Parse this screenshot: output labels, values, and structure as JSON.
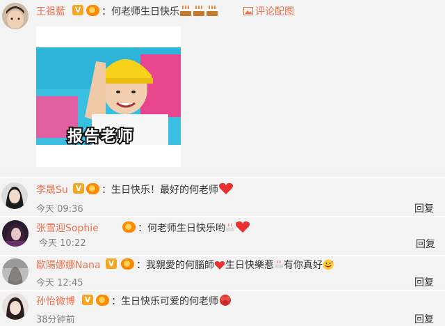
{
  "comments": [
    {
      "user": "王祖藍",
      "text": "：何老师生日快乐",
      "pic_link": "评论配图",
      "emoji": [
        "cake-emoji",
        "cake-emoji",
        "cake-emoji"
      ]
    },
    {
      "user": "李晟Su",
      "text": "：生日快乐！最好的何老师",
      "time": "今天 09:36",
      "reply": "回复"
    },
    {
      "user": "张雪迎Sophie",
      "text": "：何老师生日快乐哟",
      "time": "今天 10:22",
      "reply": "回复"
    },
    {
      "user": "歐陽娜娜Nana",
      "text_a": "：我親愛的何腦師",
      "text_b": "生日快樂惹",
      "text_c": "有你真好",
      "time": "今天 12:45",
      "reply": "回复"
    },
    {
      "user": "孙怡微博",
      "text": "：生日快乐可爱的何老师",
      "time": "38分钟前",
      "reply": "回复"
    }
  ],
  "gif_caption": "报告老师",
  "colors": {
    "username": "#eb7350",
    "background": "#f3f3f3",
    "vip_badge": "#f5a623",
    "heart": "#e8302e"
  }
}
